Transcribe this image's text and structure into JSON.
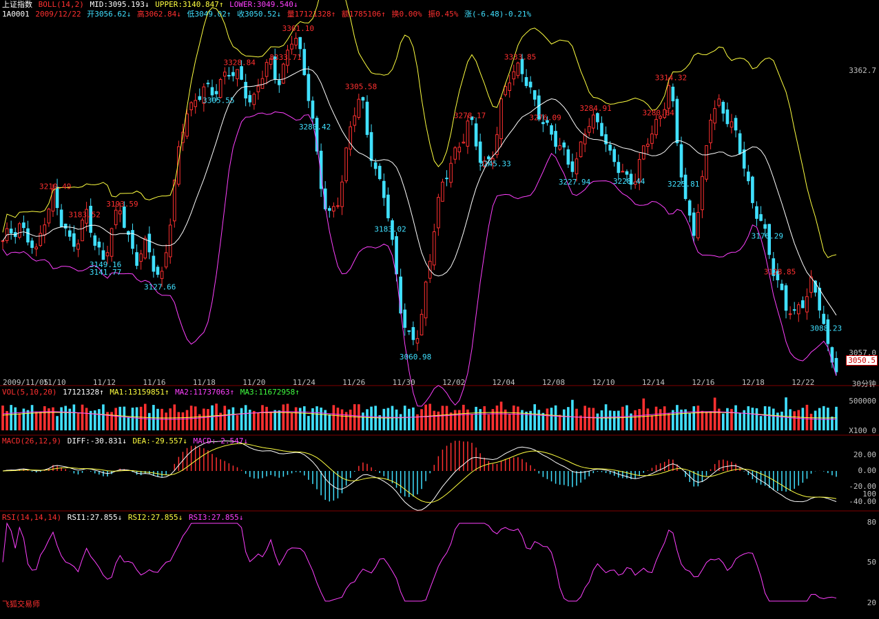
{
  "header": {
    "line1": {
      "index_name": "上证指数",
      "boll_label": "BOLL(14,2)",
      "mid": "MID:3095.193↓",
      "upper": "UPPER:3140.847↑",
      "lower": "LOWER:3049.540↓"
    },
    "line2": {
      "code": "1A0001",
      "date": "2009/12/22",
      "open": "开3056.62↓",
      "high": "高3062.84↓",
      "low": "低3049.02↑",
      "close": "收3050.52↓",
      "volume": "量17121328↑",
      "amount": "额1785106↑",
      "turnover": "换0.00%",
      "amplitude": "振0.45%",
      "change": "涨(-6.48)-0.21%"
    }
  },
  "price_axis": {
    "top": "3362.7",
    "bottom": "3057.0",
    "last": "3050.5"
  },
  "dates": [
    "2009/11/05",
    "11/10",
    "11/12",
    "11/16",
    "11/18",
    "11/20",
    "11/24",
    "11/26",
    "11/30",
    "12/02",
    "12/04",
    "12/08",
    "12/10",
    "12/14",
    "12/16",
    "12/18",
    "12/22"
  ],
  "period": "30分钟",
  "price_annotations": {
    "highs": [
      "3183.52",
      "3210.49",
      "3193.59",
      "3328.84",
      "3333.71",
      "3361.10",
      "3305.58",
      "3278.17",
      "3333.85",
      "3284.91",
      "3276.09",
      "3280.64",
      "3314.32",
      "3128.85"
    ],
    "lows": [
      "3141.77",
      "3149.16",
      "3127.66",
      "3280.42",
      "3305.55",
      "3183.02",
      "3060.98",
      "3227.94",
      "3245.33",
      "3228.44",
      "3225.81",
      "3176.29",
      "3088.23"
    ]
  },
  "volume_pane": {
    "label": "VOL(5,10,20)",
    "value": "17121328↑",
    "ma1": "MA1:13159851↑",
    "ma2": "MA2:11737063↑",
    "ma3": "MA3:11672958↑",
    "axis_top": "500000",
    "axis_bottom": "X100  0"
  },
  "macd_pane": {
    "label": "MACD(26,12,9)",
    "diff": "DIFF:-30.831↓",
    "dea": "DEA:-29.557↓",
    "macd": "MACD:-2.547↓",
    "axis": [
      "20.00",
      "0.00",
      "-20.00",
      "-40.00"
    ],
    "axis_extra": "100"
  },
  "rsi_pane": {
    "label": "RSI(14,14,14)",
    "rsi1": "RSI1:27.855↓",
    "rsi2": "RSI2:27.855↓",
    "rsi3": "RSI3:27.855↓",
    "axis": [
      "80",
      "50",
      "20"
    ]
  },
  "brand": "飞狐交易师",
  "colors": {
    "up": "#ff3030",
    "down": "#40e0ff",
    "mid": "#ffffff",
    "upper": "#ffff40",
    "lower": "#ff40ff",
    "rsi": "#ff40ff"
  },
  "chart_data": {
    "type": "line",
    "title": "上证指数 BOLL(14,2)",
    "xlabel": "",
    "ylabel": "",
    "x_ticks": [
      "2009/11/05",
      "11/10",
      "11/12",
      "11/16",
      "11/18",
      "11/20",
      "11/24",
      "11/26",
      "11/30",
      "12/02",
      "12/04",
      "12/08",
      "12/10",
      "12/14",
      "12/16",
      "12/18",
      "12/22"
    ],
    "ylim": [
      3040,
      3375
    ],
    "close_path": [
      3160,
      3175,
      3183,
      3165,
      3150,
      3190,
      3210,
      3180,
      3165,
      3170,
      3190,
      3160,
      3150,
      3175,
      3193,
      3170,
      3150,
      3160,
      3140,
      3130,
      3180,
      3240,
      3290,
      3300,
      3310,
      3300,
      3320,
      3328,
      3320,
      3310,
      3300,
      3320,
      3333,
      3320,
      3340,
      3361,
      3330,
      3300,
      3220,
      3185,
      3200,
      3240,
      3280,
      3305,
      3260,
      3220,
      3200,
      3150,
      3090,
      3062,
      3080,
      3140,
      3190,
      3220,
      3250,
      3260,
      3278,
      3250,
      3240,
      3250,
      3300,
      3330,
      3333,
      3310,
      3290,
      3284,
      3260,
      3250,
      3240,
      3245,
      3270,
      3280,
      3275,
      3240,
      3230,
      3225,
      3230,
      3250,
      3270,
      3290,
      3314,
      3250,
      3200,
      3176,
      3220,
      3290,
      3300,
      3280,
      3260,
      3240,
      3200,
      3180,
      3150,
      3130,
      3100,
      3090,
      3110,
      3128,
      3100,
      3060,
      3050
    ],
    "series": [
      {
        "name": "MID",
        "values": [
          3095.193
        ]
      },
      {
        "name": "UPPER",
        "values": [
          3140.847
        ]
      },
      {
        "name": "LOWER",
        "values": [
          3049.54
        ]
      }
    ],
    "last": {
      "date": "2009/12/22",
      "open": 3056.62,
      "high": 3062.84,
      "low": 3049.02,
      "close": 3050.52
    }
  }
}
